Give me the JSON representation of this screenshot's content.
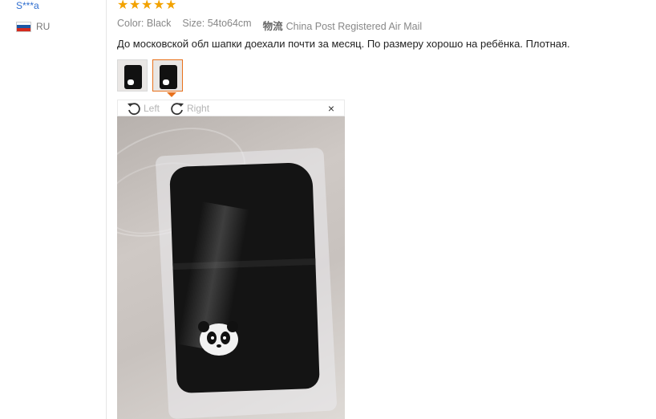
{
  "reviewer": {
    "name": "S***a",
    "country": "RU",
    "flag_colors": [
      "#ffffff",
      "#1c57a5",
      "#d52b1e"
    ]
  },
  "rating": {
    "stars": 5,
    "max": 5,
    "color": "#f2a200"
  },
  "meta": {
    "color_label": "Color:",
    "color_value": "Black",
    "size_label": "Size:",
    "size_value": "54to64cm",
    "shipping_label": "物流",
    "shipping_value": "China Post Registered Air Mail"
  },
  "review_text": "До московской обл шапки доехали почти за месяц. По размеру хорошо на ребёнка. Плотная.",
  "thumbnails": [
    {
      "name": "photo-thumb-1",
      "active": false
    },
    {
      "name": "photo-thumb-2",
      "active": true
    }
  ],
  "viewer": {
    "rotate_left_label": "Left",
    "rotate_right_label": "Right",
    "close_symbol": "×",
    "accent_color": "#e8711c"
  }
}
